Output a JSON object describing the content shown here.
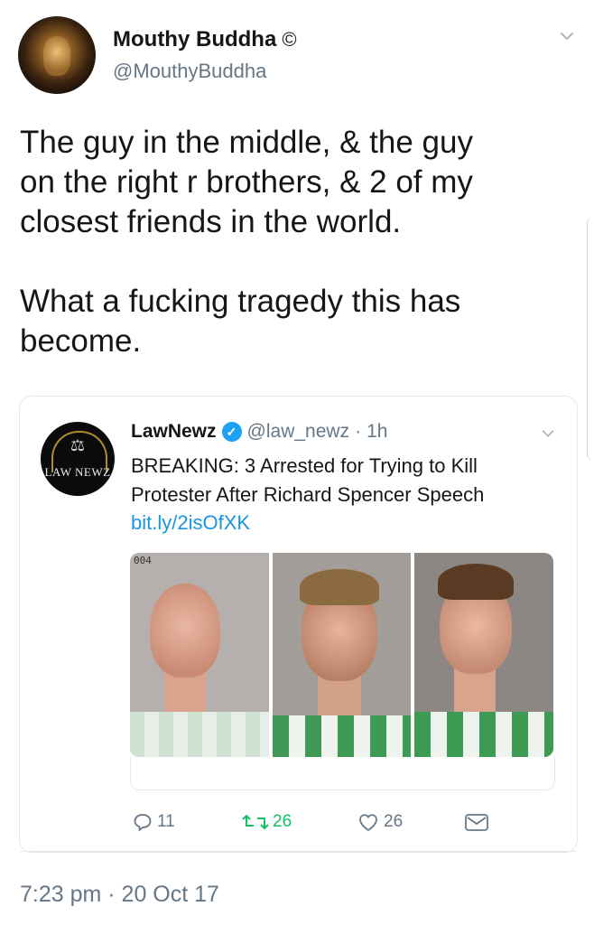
{
  "author": {
    "display_name": "Mouthy Buddha",
    "badge": "©",
    "handle": "@MouthyBuddha",
    "avatar_icon": "buddha-avatar"
  },
  "tweet": {
    "text": "The guy in the middle, & the guy\non the right r brothers, & 2 of my\nclosest friends in the world.\n\nWhat a fucking tragedy this has\nbecome."
  },
  "quoted": {
    "display_name": "LawNewz",
    "handle": "@law_newz",
    "separator": "·",
    "age": "1h",
    "avatar_text": "LAW NEWZ",
    "text": "BREAKING: 3 Arrested for Trying to Kill\nProtester After Richard Spencer Speech",
    "link": "bit.ly/2isOfXK",
    "photo_label": "004"
  },
  "actions": {
    "replies": "11",
    "retweets": "26",
    "likes": "26"
  },
  "timestamp": "7:23 pm · 20 Oct 17",
  "colors": {
    "link": "#1b95e0",
    "muted": "#657786",
    "retweet": "#17bf63",
    "verified": "#1da1f2"
  }
}
